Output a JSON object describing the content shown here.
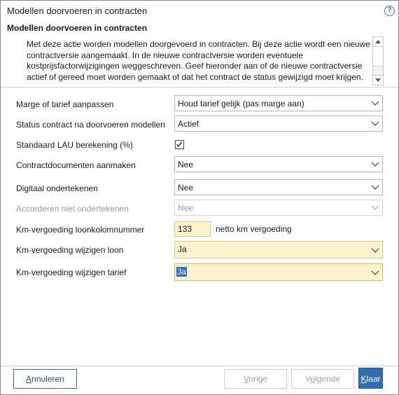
{
  "window": {
    "title": "Modellen doorvoeren in contracten"
  },
  "section": {
    "title": "Modellen doorvoeren in contracten",
    "description_lines": [
      "Met deze actie worden modellen doorgevoerd in contracten. Bij deze actie wordt een nieuwe",
      "contractversie aangemaakt. In de nieuwe contractversie worden eventuele",
      "kostprijsfactorwijzigingen weggeschreven. Geef hieronder aan of de nieuwe contractversie",
      "actief of gereed moet worden gemaakt of dat het contract de status gewijzigd moet krijgen."
    ]
  },
  "fields": {
    "marge": {
      "label": "Marge of tarief aanpassen",
      "value": "Houd tarief gelijk (pas marge aan)"
    },
    "status": {
      "label": "Status contract na doorvoeren modellen",
      "value": "Actief"
    },
    "lau": {
      "label": "Standaard LAU berekening (%)",
      "checked": true
    },
    "docs": {
      "label": "Contractdocumenten aanmaken",
      "value": "Nee"
    },
    "digitaal": {
      "label": "Digitaal ondertekenen",
      "value": "Nee"
    },
    "accorderen": {
      "label": "Accorderen niet ondertekenen",
      "value": "Nee"
    },
    "km_kolom": {
      "label": "Km-vergoeding loonkolomnummer",
      "value": "133",
      "suffix": "netto km vergoeding"
    },
    "km_loon": {
      "label": "Km-vergoeding wijzigen loon",
      "value": "Ja"
    },
    "km_tarief": {
      "label": "Km-vergoeding wijzigen tarief",
      "value": "Ja"
    }
  },
  "footer": {
    "cancel": {
      "accel": "A",
      "rest": "nnuleren"
    },
    "prev": {
      "accel": "V",
      "rest": "orige"
    },
    "next": {
      "pre": "V",
      "accel": "o",
      "rest": "lgende"
    },
    "finish": {
      "accel": "K",
      "rest": "laar"
    }
  },
  "colors": {
    "accent": "#2f6db5",
    "highlight_bg": "#fdf2cc",
    "selection": "#2b6fd1"
  }
}
